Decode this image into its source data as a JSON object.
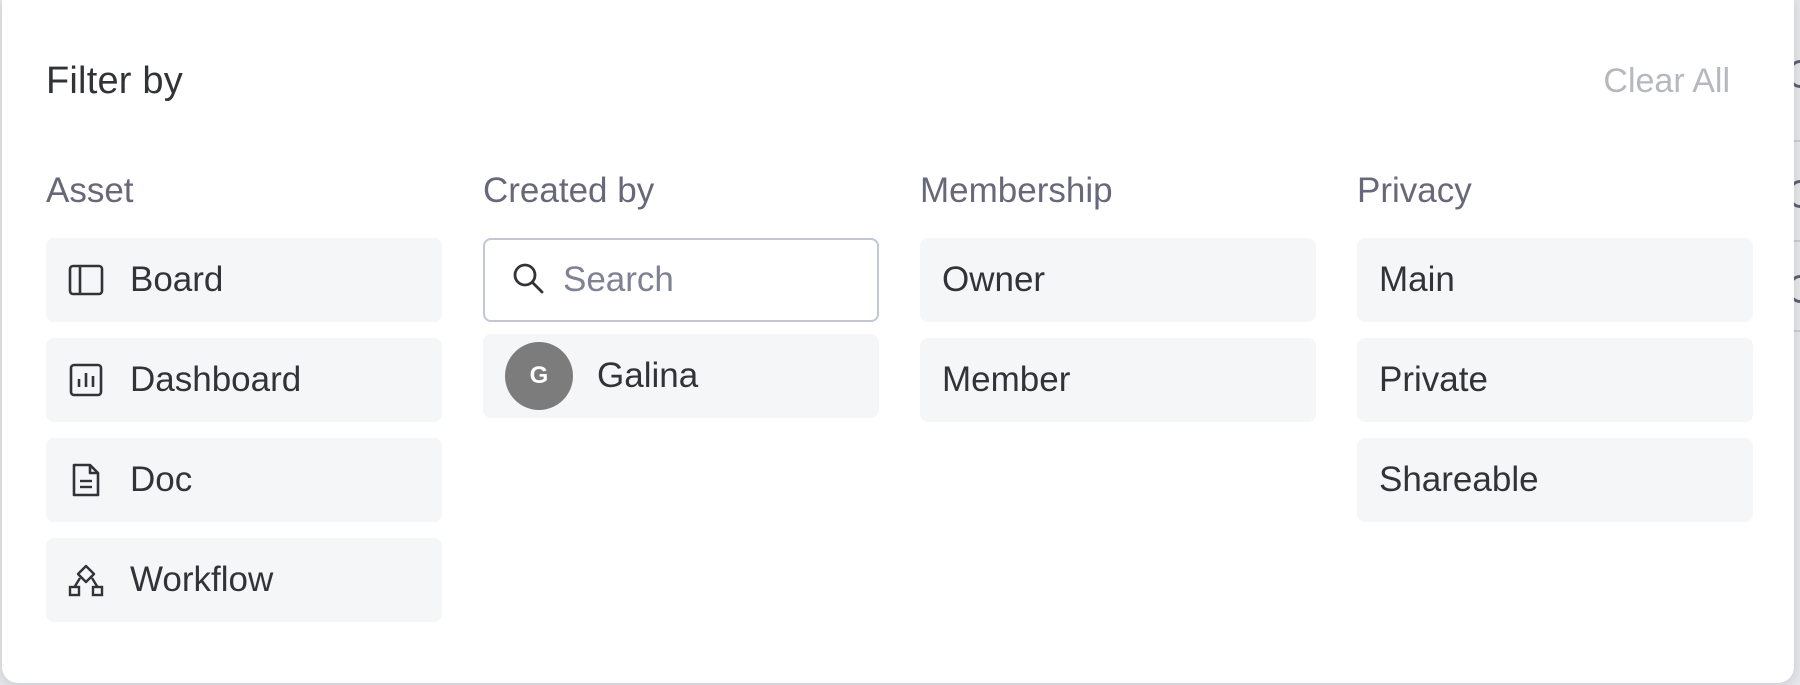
{
  "header": {
    "title": "Filter by",
    "clear_all": "Clear All"
  },
  "asset": {
    "heading": "Asset",
    "items": [
      {
        "label": "Board",
        "icon": "board-icon"
      },
      {
        "label": "Dashboard",
        "icon": "dashboard-icon"
      },
      {
        "label": "Doc",
        "icon": "doc-icon"
      },
      {
        "label": "Workflow",
        "icon": "workflow-icon"
      }
    ]
  },
  "created_by": {
    "heading": "Created by",
    "search_placeholder": "Search",
    "people": [
      {
        "initial": "G",
        "name": "Galina"
      }
    ]
  },
  "membership": {
    "heading": "Membership",
    "items": [
      {
        "label": "Owner"
      },
      {
        "label": "Member"
      }
    ]
  },
  "privacy": {
    "heading": "Privacy",
    "items": [
      {
        "label": "Main"
      },
      {
        "label": "Private"
      },
      {
        "label": "Shareable"
      }
    ]
  },
  "colors": {
    "option_bg": "#f5f6f8",
    "heading_text": "#676879",
    "primary_text": "#323338",
    "muted_text": "#b6b8c0",
    "avatar_bg": "#7c7c7c"
  }
}
